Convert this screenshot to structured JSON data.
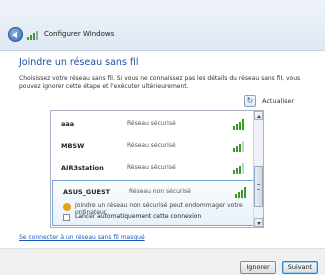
{
  "window": {
    "title": "Configurer Windows"
  },
  "page": {
    "heading": "Joindre un réseau sans fil",
    "description": "Choisissez votre réseau sans fil. Si vous ne connaissez pas les détails du réseau sans fil, vous pouvez ignorer cette étape et l'exécuter ultérieurement."
  },
  "toolbar": {
    "refresh_label": "Actualiser"
  },
  "networks": [
    {
      "name": "aaa",
      "status": "Réseau sécurisé"
    },
    {
      "name": "MBSW",
      "status": "Réseau sécurisé"
    },
    {
      "name": "AIR3station",
      "status": "Réseau sécurisé"
    }
  ],
  "selected_network": {
    "name": "ASUS_GUEST",
    "status": "Réseau non sécurisé",
    "warning": "Joindre un réseau non sécurisé peut endommager votre ordinateur.",
    "auto_connect_label": "Lancer automatiquement cette connexion",
    "auto_connect_checked": false
  },
  "hidden_network_link": "Se connecter à un réseau sans fil masqué",
  "buttons": {
    "ignore": "Ignorer",
    "next": "Suivant"
  },
  "colors": {
    "heading": "#1e4fa3",
    "link": "#1a57c4",
    "signal": "#3a9a2a",
    "warning": "#e6a210"
  },
  "icons": {
    "back": "back-arrow-icon",
    "wifi": "wifi-signal-icon",
    "refresh": "refresh-icon",
    "warning": "warning-shield-icon"
  }
}
